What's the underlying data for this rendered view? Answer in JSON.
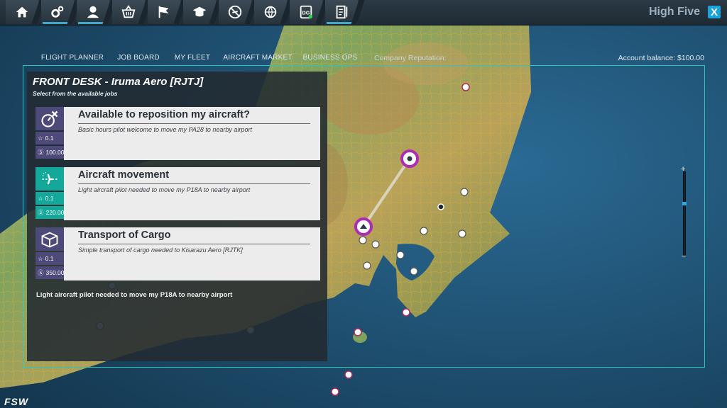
{
  "window": {
    "title": "High Five",
    "close_label": "X"
  },
  "nav": [
    {
      "name": "home-icon",
      "active": false
    },
    {
      "name": "settings-gears-icon",
      "active": true
    },
    {
      "name": "profile-icon",
      "active": true
    },
    {
      "name": "basket-icon",
      "active": false
    },
    {
      "name": "flag-icon",
      "active": false
    },
    {
      "name": "graduation-cap-icon",
      "active": false
    },
    {
      "name": "no-flight-icon",
      "active": false
    },
    {
      "name": "globe-route-icon",
      "active": false
    },
    {
      "name": "dg-device-icon",
      "active": false
    },
    {
      "name": "checklist-icon",
      "active": true
    }
  ],
  "tabs": [
    {
      "label": "FLIGHT PLANNER",
      "active": false
    },
    {
      "label": "JOB BOARD",
      "active": true
    },
    {
      "label": "MY FLEET",
      "active": false
    },
    {
      "label": "AIRCRAFT MARKET",
      "active": false
    },
    {
      "label": "BUSINESS OPS",
      "active": false
    }
  ],
  "company": {
    "reputation_label": "Company Reputation:"
  },
  "account": {
    "balance_label": "Account balance: $100.00"
  },
  "front_desk": {
    "title": "FRONT DESK - Iruma Aero [RJTJ]",
    "subtitle": "Select from the available jobs",
    "jobs": [
      {
        "title": "Available to reposition my aircraft?",
        "desc": "Basic hours pilot welcome to move my PA28 to nearby airport",
        "rating": "0.1",
        "pay": "100.00",
        "icon": "reposition-icon",
        "color": "#4d4978"
      },
      {
        "title": "Aircraft movement",
        "desc": "Light aircraft pilot needed to move my P18A to nearby airport",
        "rating": "0.1",
        "pay": "220.00",
        "icon": "aircraft-movement-icon",
        "color": "#13a899"
      },
      {
        "title": "Transport of Cargo",
        "desc": "Simple transport of cargo needed to Kisarazu Aero [RJTK]",
        "rating": "0.1",
        "pay": "350.00",
        "icon": "cargo-box-icon",
        "color": "#4d4978"
      }
    ],
    "selected_desc": "Light aircraft pilot needed to move my P18A to nearby airport"
  },
  "zoom": {
    "plus": "+",
    "minus": "−",
    "level": 0.65
  },
  "brand": {
    "logo_text": "FSW"
  },
  "colors": {
    "accent_teal": "#2fc4ba",
    "nav_active": "#3fa9c9",
    "route_ring": "#b02bb5",
    "sea": "#1c4b6e"
  }
}
